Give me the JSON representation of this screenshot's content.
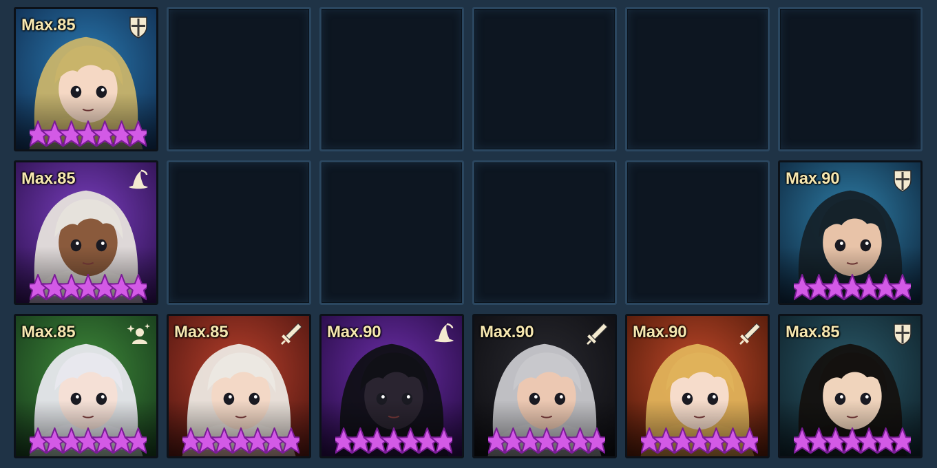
{
  "grid": {
    "heroes": [
      {
        "slot": 1,
        "max_label": "Max.85",
        "class_icon": "shield-icon",
        "stars": 7,
        "bg": [
          "#2a79b0",
          "#0f2a4c"
        ],
        "hair": "#c9b46a",
        "skin": "#f5d8c4"
      },
      {
        "slot": 7,
        "max_label": "Max.85",
        "class_icon": "wizard-hat-icon",
        "stars": 7,
        "bg": [
          "#7a3fbf",
          "#2a0f4a"
        ],
        "hair": "#e6e2dc",
        "skin": "#8a5a3c"
      },
      {
        "slot": 12,
        "max_label": "Max.90",
        "class_icon": "shield-icon",
        "stars": 7,
        "bg": [
          "#2f7fa8",
          "#0c2238"
        ],
        "hair": "#15222a",
        "skin": "#e8c3a8"
      },
      {
        "slot": 13,
        "max_label": "Max.85",
        "class_icon": "support-sparkle-icon",
        "stars": 7,
        "bg": [
          "#3f8a3a",
          "#15361a"
        ],
        "hair": "#e8e8ee",
        "skin": "#f5e0d6"
      },
      {
        "slot": 14,
        "max_label": "Max.85",
        "class_icon": "sword-icon",
        "stars": 7,
        "bg": [
          "#b8402c",
          "#4a140f"
        ],
        "hair": "#ece8e2",
        "skin": "#f3d8c6"
      },
      {
        "slot": 15,
        "max_label": "Max.90",
        "class_icon": "wizard-hat-icon",
        "stars": 7,
        "bg": [
          "#6c2fa8",
          "#22093e"
        ],
        "hair": "#101016",
        "skin": "#2a2430"
      },
      {
        "slot": 16,
        "max_label": "Max.90",
        "class_icon": "sword-icon",
        "stars": 7,
        "bg": [
          "#2a2a30",
          "#0c0c10"
        ],
        "hair": "#c8c8cc",
        "skin": "#ecc8b2"
      },
      {
        "slot": 17,
        "max_label": "Max.90",
        "class_icon": "sword-icon",
        "stars": 7,
        "bg": [
          "#c0482a",
          "#4a1808"
        ],
        "hair": "#e0b25a",
        "skin": "#f6dccb"
      },
      {
        "slot": 18,
        "max_label": "Max.85",
        "class_icon": "shield-icon",
        "stars": 7,
        "bg": [
          "#2b5a6a",
          "#0d1e26"
        ],
        "hair": "#14110f",
        "skin": "#f0d4bc"
      }
    ],
    "empty_slots": [
      2,
      3,
      4,
      5,
      6,
      8,
      9,
      10,
      11
    ]
  },
  "colors": {
    "star": "#d35ae6",
    "star_edge": "#7a1c96",
    "label": "#f6e7b0",
    "icon": "#f4ead0"
  }
}
